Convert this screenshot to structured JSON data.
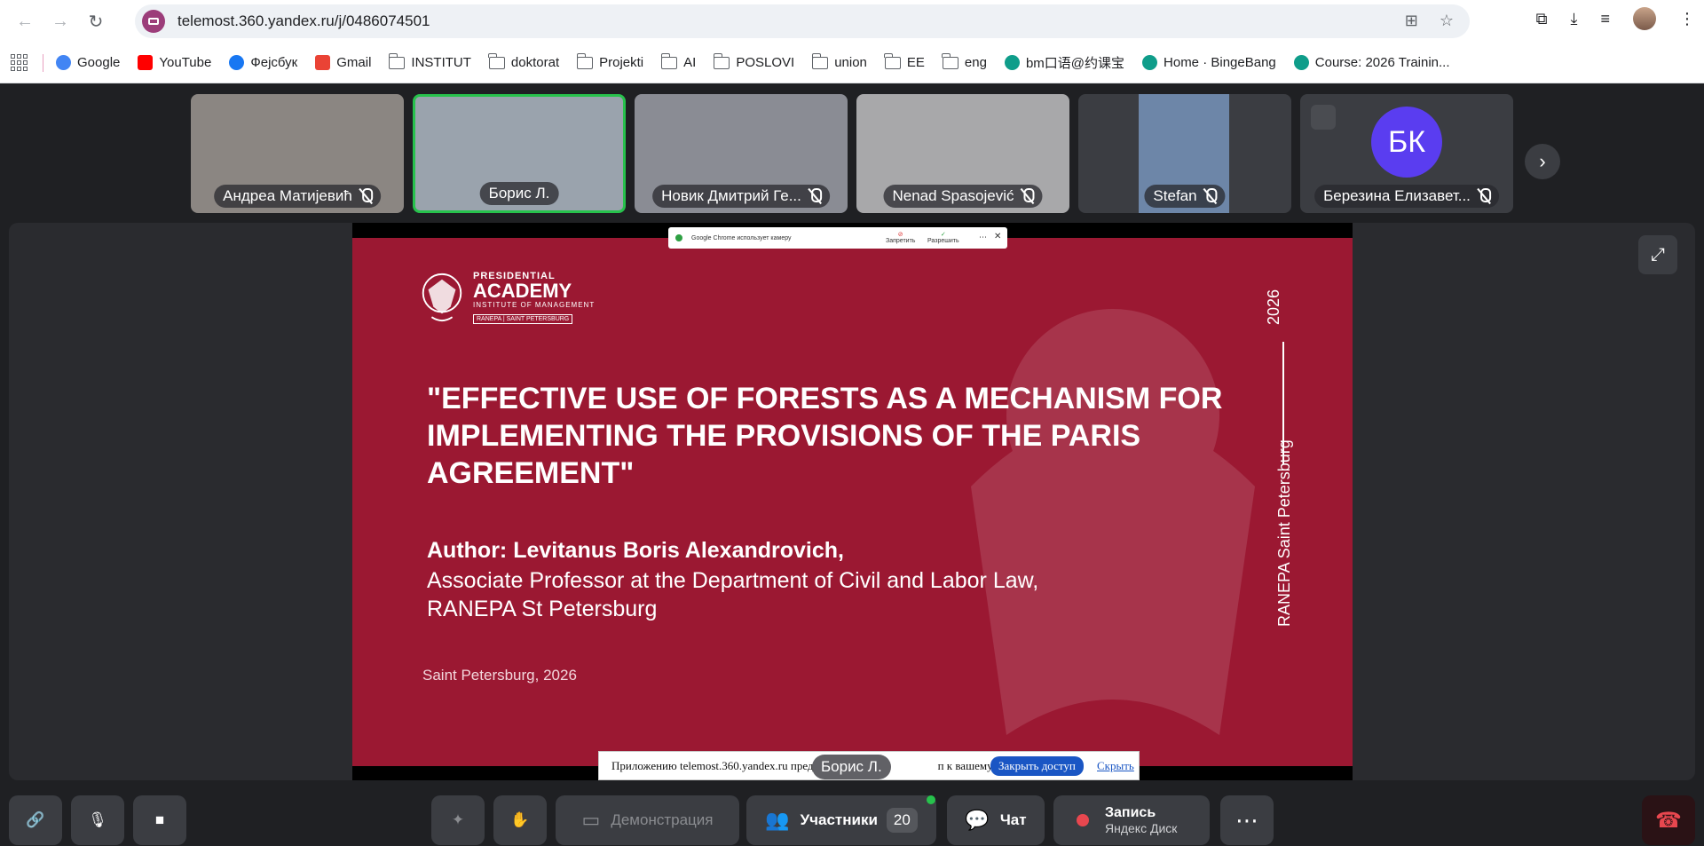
{
  "browser": {
    "url": "telemost.360.yandex.ru/j/0486074501"
  },
  "bookmarks": [
    {
      "label": "Google",
      "type": "google"
    },
    {
      "label": "YouTube",
      "type": "youtube"
    },
    {
      "label": "Фејсбук",
      "type": "facebook"
    },
    {
      "label": "Gmail",
      "type": "gmail"
    },
    {
      "label": "INSTITUT",
      "type": "folder"
    },
    {
      "label": "doktorat",
      "type": "folder"
    },
    {
      "label": "Projekti",
      "type": "folder"
    },
    {
      "label": "AI",
      "type": "folder"
    },
    {
      "label": "POSLOVI",
      "type": "folder"
    },
    {
      "label": "union",
      "type": "folder"
    },
    {
      "label": "EE",
      "type": "folder"
    },
    {
      "label": "eng",
      "type": "folder"
    },
    {
      "label": "bm口语@约课宝",
      "type": "site"
    },
    {
      "label": "Home · BingeBang",
      "type": "site"
    },
    {
      "label": "Course: 2026 Trainin...",
      "type": "site"
    }
  ],
  "participants": [
    {
      "name": "Андреа Матијевић",
      "muted": true
    },
    {
      "name": "Борис Л.",
      "muted": false,
      "active": true
    },
    {
      "name": "Новик Дмитрий Ге...",
      "muted": true
    },
    {
      "name": "Nenad Spasojević",
      "muted": true
    },
    {
      "name": "Stefan",
      "muted": true
    },
    {
      "name": "Березина Елизавет...",
      "muted": true,
      "initials": "БК"
    }
  ],
  "slide": {
    "logo_line1": "PRESIDENTIAL",
    "logo_line2": "ACADEMY",
    "logo_line3": "INSTITUTE OF MANAGEMENT",
    "logo_line4": "RANEPA | SAINT PETERSBURG",
    "title": "\"EFFECTIVE USE OF FORESTS AS A MECHANISM FOR IMPLEMENTING THE PROVISIONS OF THE PARIS AGREEMENT\"",
    "author": "Author: Levitanus Boris Alexandrovich,",
    "affiliation_line1": "Associate Professor at the Department of Civil and Labor Law,",
    "affiliation_line2": "RANEPA St Petersburg",
    "place": "Saint Petersburg, 2026",
    "year": "2026",
    "side_text": "RANEPA Saint Petersburg"
  },
  "camera_popup": {
    "text": "Google Chrome использует камеру",
    "deny": "Запретить",
    "allow": "Разрешить"
  },
  "share_notice": {
    "text": "Приложению telemost.360.yandex.ru пред",
    "text_tail": "п к вашему экрану.",
    "stop": "Закрыть доступ",
    "hide": "Скрыть"
  },
  "speaker_label": "Борис Л.",
  "controls": {
    "demo": "Демонстрация",
    "participants": "Участники",
    "participants_count": "20",
    "chat": "Чат",
    "record": "Запись",
    "record_sub": "Яндекс Диск"
  }
}
